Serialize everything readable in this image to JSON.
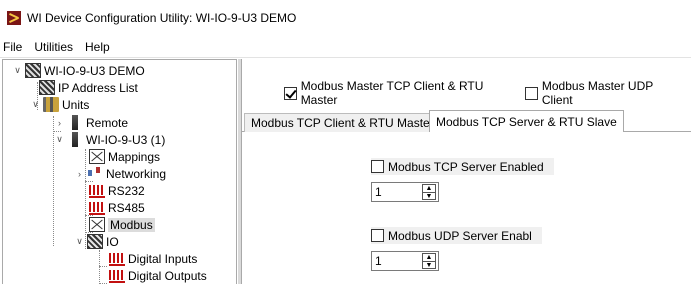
{
  "window": {
    "title": "WI Device Configuration Utility: WI-IO-9-U3 DEMO",
    "app_icon": "wi-logo-icon"
  },
  "menu": {
    "items": [
      "File",
      "Utilities",
      "Help"
    ]
  },
  "tree": {
    "root": "WI-IO-9-U3 DEMO",
    "ip_address_list": "IP Address List",
    "units": "Units",
    "remote": "Remote",
    "unit": "WI-IO-9-U3 (1)",
    "mappings": "Mappings",
    "networking": "Networking",
    "rs232": "RS232",
    "rs485": "RS485",
    "modbus": "Modbus",
    "io": "IO",
    "digital_inputs": "Digital Inputs",
    "digital_outputs": "Digital Outputs",
    "selected": "Modbus"
  },
  "modbus": {
    "master_tcp_rtu": {
      "label": "Modbus Master TCP Client & RTU Master",
      "checked": true
    },
    "master_udp": {
      "label": "Modbus Master UDP Client",
      "checked": false
    },
    "tabs": [
      "Modbus TCP Client & RTU Master",
      "Modbus TCP Server & RTU Slave"
    ],
    "active_tab": "Modbus TCP Server & RTU Slave",
    "tcp_server_enabled": {
      "label": "Modbus TCP Server Enabled",
      "checked": false,
      "value": "1"
    },
    "udp_server_enabled": {
      "label": "Modbus UDP Server Enabl",
      "checked": false,
      "value": "1"
    }
  },
  "colors": {
    "serial_icon": "#c21010",
    "border": "#a9a9a9",
    "selected_bg": "#dcdcdc"
  }
}
